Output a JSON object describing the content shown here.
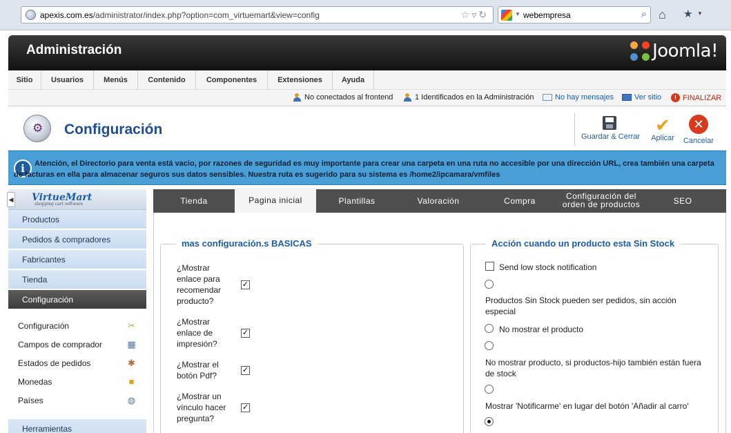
{
  "browser": {
    "url_host": "apexis.com.es",
    "url_path": "/administrator/index.php?option=com_virtuemart&view=config",
    "search_text": "webempresa"
  },
  "header": {
    "title": "Administración",
    "brand": "Joomla!"
  },
  "menu": {
    "items": [
      "Sitio",
      "Usuarios",
      "Menús",
      "Contenido",
      "Componentes",
      "Extensiones",
      "Ayuda"
    ]
  },
  "status": {
    "frontend": "No conectados al frontend",
    "admin": "1 Identificados en la Administración",
    "messages": "No hay mensajes",
    "view_site": "Ver sitio",
    "logout": "FINALIZAR"
  },
  "toolbar": {
    "title": "Configuración",
    "save_close": "Guardar & Cerrar",
    "apply": "Aplicar",
    "cancel": "Cancelar"
  },
  "notice": {
    "text": "Atención, el Directorio para venta está vacio, por razones de seguridad es muy importante para crear una carpeta en una ruta no accesible por una dirección URL, crea también una carpeta de facturas en ella para almacenar seguros sus datos sensibles. Nuestra ruta es sugerido para su sistema es /home2/ipcamara/vmfiles"
  },
  "sidebar": {
    "logo": "VirtueMart",
    "logo_tagline": "shopping cart software",
    "items": [
      "Productos",
      "Pedidos & compradores",
      "Fabricantes",
      "Tienda",
      "Configuración"
    ],
    "sub_items": [
      "Configuración",
      "Campos de comprador",
      "Estados de pedidos",
      "Monedas",
      "Países"
    ],
    "bottom_item": "Herramientas"
  },
  "tabs": [
    "Tienda",
    "Pagina inicial",
    "Plantillas",
    "Valoración",
    "Compra",
    "Configuración del orden de productos",
    "SEO"
  ],
  "basic": {
    "legend": "mas configuración.s BASICAS",
    "options": [
      {
        "label": "¿Mostrar enlace para recomendar producto?",
        "checked": true
      },
      {
        "label": "¿Mostrar enlace de impresión?",
        "checked": true
      },
      {
        "label": "¿Mostrar el botón Pdf?",
        "checked": true
      },
      {
        "label": "¿Mostrar un vínculo hacer pregunta?",
        "checked": true
      }
    ]
  },
  "stock": {
    "legend": "Acción cuando un producto esta Sin Stock",
    "notify_label": "Send low stock notification",
    "notify_checked": false,
    "options": [
      "Productos Sin Stock pueden ser pedidos, sin acción especial",
      "No mostrar el producto",
      "No mostrar producto, si productos-hijo también están fuera de stock",
      "Mostrar 'Notificarme' en lugar del botón 'Añadir al carro'"
    ],
    "selected_index": 4
  }
}
